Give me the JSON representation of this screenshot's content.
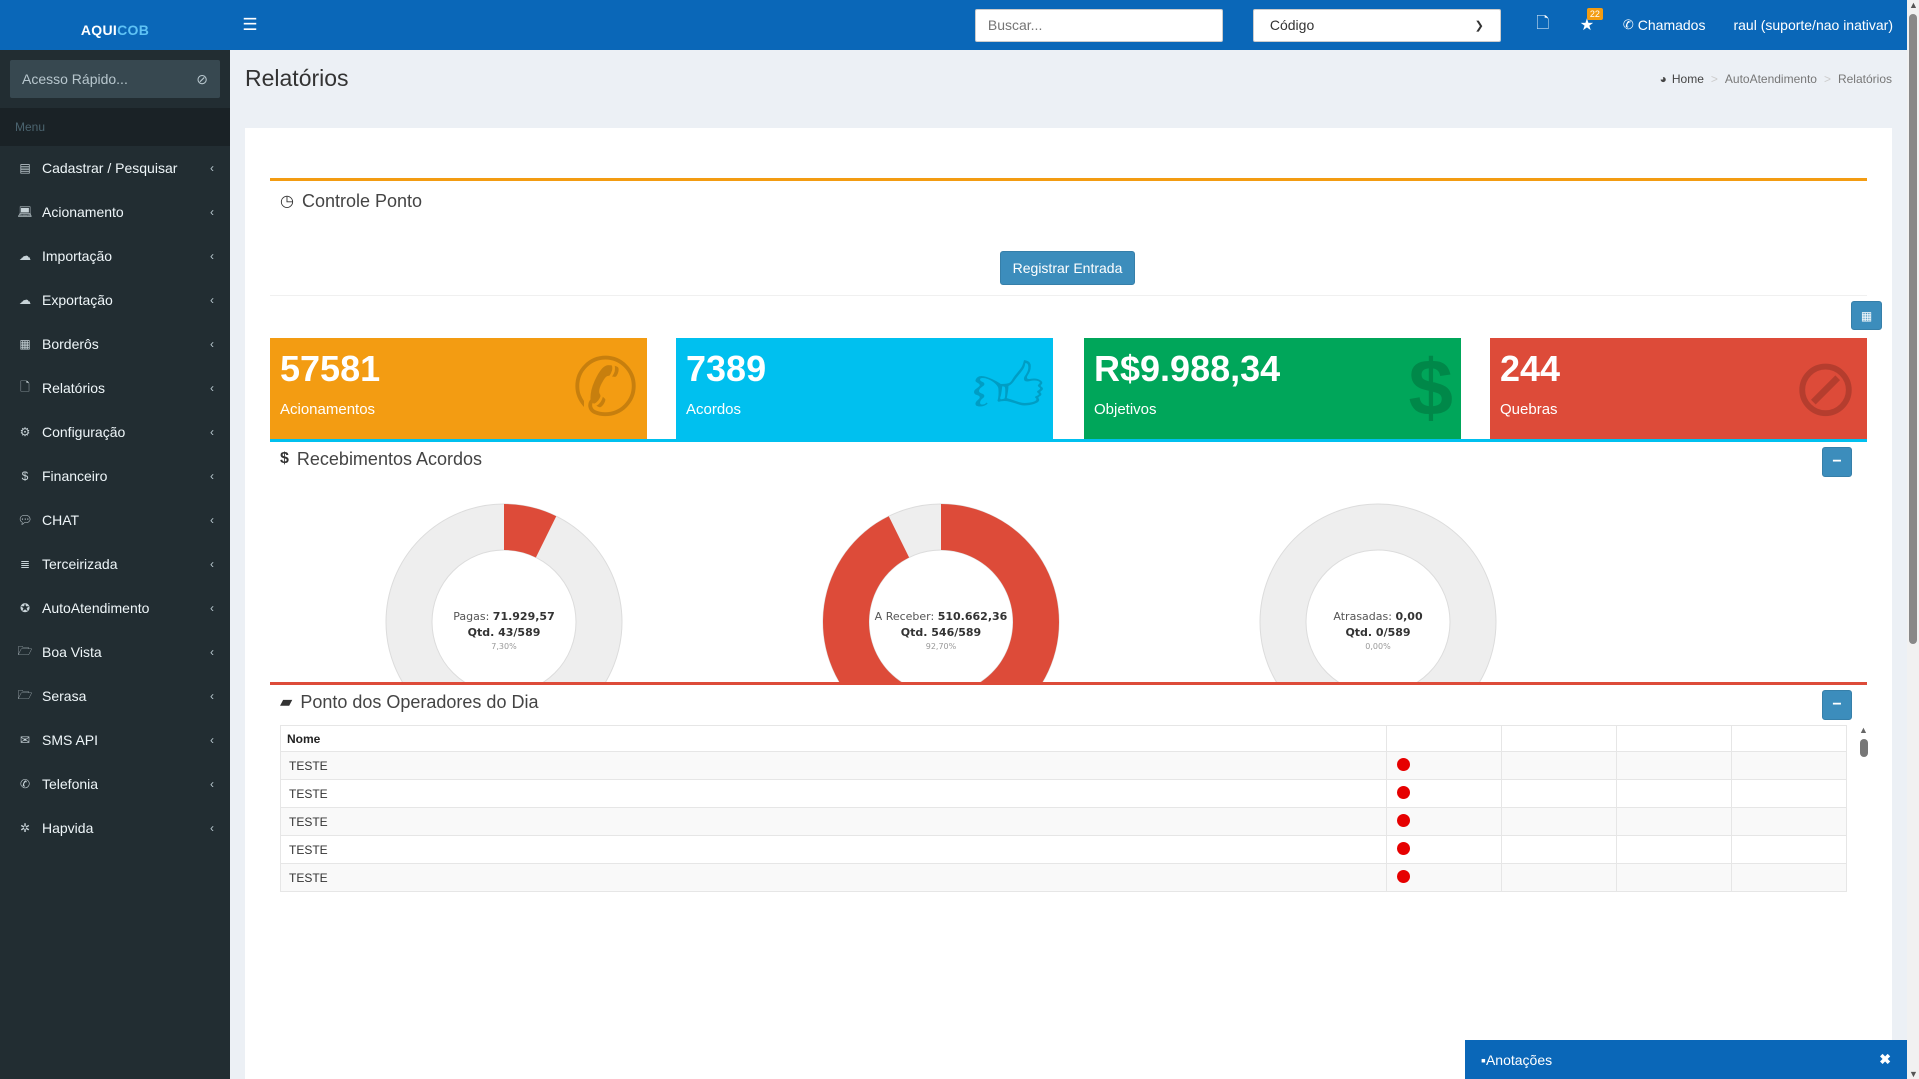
{
  "header": {
    "logo_prefix": "AQUI",
    "logo_suffix": "COB",
    "search_placeholder": "Buscar...",
    "select_value": "Código",
    "notification_count": "22",
    "calls_label": "Chamados",
    "user_label": "raul (suporte/nao inativar)"
  },
  "sidebar": {
    "quick_access_placeholder": "Acesso Rápido...",
    "menu_header": "Menu",
    "items": [
      {
        "label": "Cadastrar / Pesquisar",
        "icon": "building-icon"
      },
      {
        "label": "Acionamento",
        "icon": "laptop-icon"
      },
      {
        "label": "Importação",
        "icon": "cloud-upload-icon"
      },
      {
        "label": "Exportação",
        "icon": "cloud-download-icon"
      },
      {
        "label": "Borderôs",
        "icon": "list-icon"
      },
      {
        "label": "Relatórios",
        "icon": "file-icon"
      },
      {
        "label": "Configuração",
        "icon": "gear-icon"
      },
      {
        "label": "Financeiro",
        "icon": "dollar-icon"
      },
      {
        "label": "CHAT",
        "icon": "chat-icon"
      },
      {
        "label": "Terceirizada",
        "icon": "server-icon"
      },
      {
        "label": "AutoAtendimento",
        "icon": "android-icon"
      },
      {
        "label": "Boa Vista",
        "icon": "folder-open-icon"
      },
      {
        "label": "Serasa",
        "icon": "folder-open-icon"
      },
      {
        "label": "SMS API",
        "icon": "envelope-icon"
      },
      {
        "label": "Telefonia",
        "icon": "phone-icon"
      },
      {
        "label": "Hapvida",
        "icon": "asterisk-icon"
      }
    ]
  },
  "page": {
    "title": "Relatórios",
    "breadcrumb": [
      "Home",
      "AutoAtendimento",
      "Relatórios"
    ]
  },
  "controle_ponto": {
    "title": "Controle Ponto",
    "button": "Registrar Entrada"
  },
  "stats": [
    {
      "value": "57581",
      "label": "Acionamentos",
      "color": "#f39c12",
      "icon": "phone-icon"
    },
    {
      "value": "7389",
      "label": "Acordos",
      "color": "#00c0ef",
      "icon": "thumbs-up-icon"
    },
    {
      "value": "R$9.988,34",
      "label": "Objetivos",
      "color": "#00a65a",
      "icon": "dollar-icon"
    },
    {
      "value": "244",
      "label": "Quebras",
      "color": "#dd4b39",
      "icon": "ban-icon"
    }
  ],
  "recebimentos": {
    "title": "Recebimentos Acordos",
    "donuts": [
      {
        "label": "Pagas",
        "amount": "71.929,57",
        "qty": "Qtd. 43/589",
        "percent_text": "7,30%",
        "fraction": 0.073,
        "color": "#dd4b39"
      },
      {
        "label": "A Receber",
        "amount": "510.662,36",
        "qty": "Qtd. 546/589",
        "percent_text": "92,70%",
        "fraction": 0.927,
        "color": "#dd4b39"
      },
      {
        "label": "Atrasadas",
        "amount": "0,00",
        "qty": "Qtd. 0/589",
        "percent_text": "0,00%",
        "fraction": 0.0,
        "color": "#dd4b39"
      }
    ]
  },
  "ponto_operadores": {
    "title": "Ponto dos Operadores do Dia",
    "column_name": "Nome",
    "rows": [
      "TESTE",
      "TESTE",
      "TESTE",
      "TESTE",
      "TESTE"
    ]
  },
  "notes": {
    "label": "Anotações",
    "close": "✖"
  }
}
